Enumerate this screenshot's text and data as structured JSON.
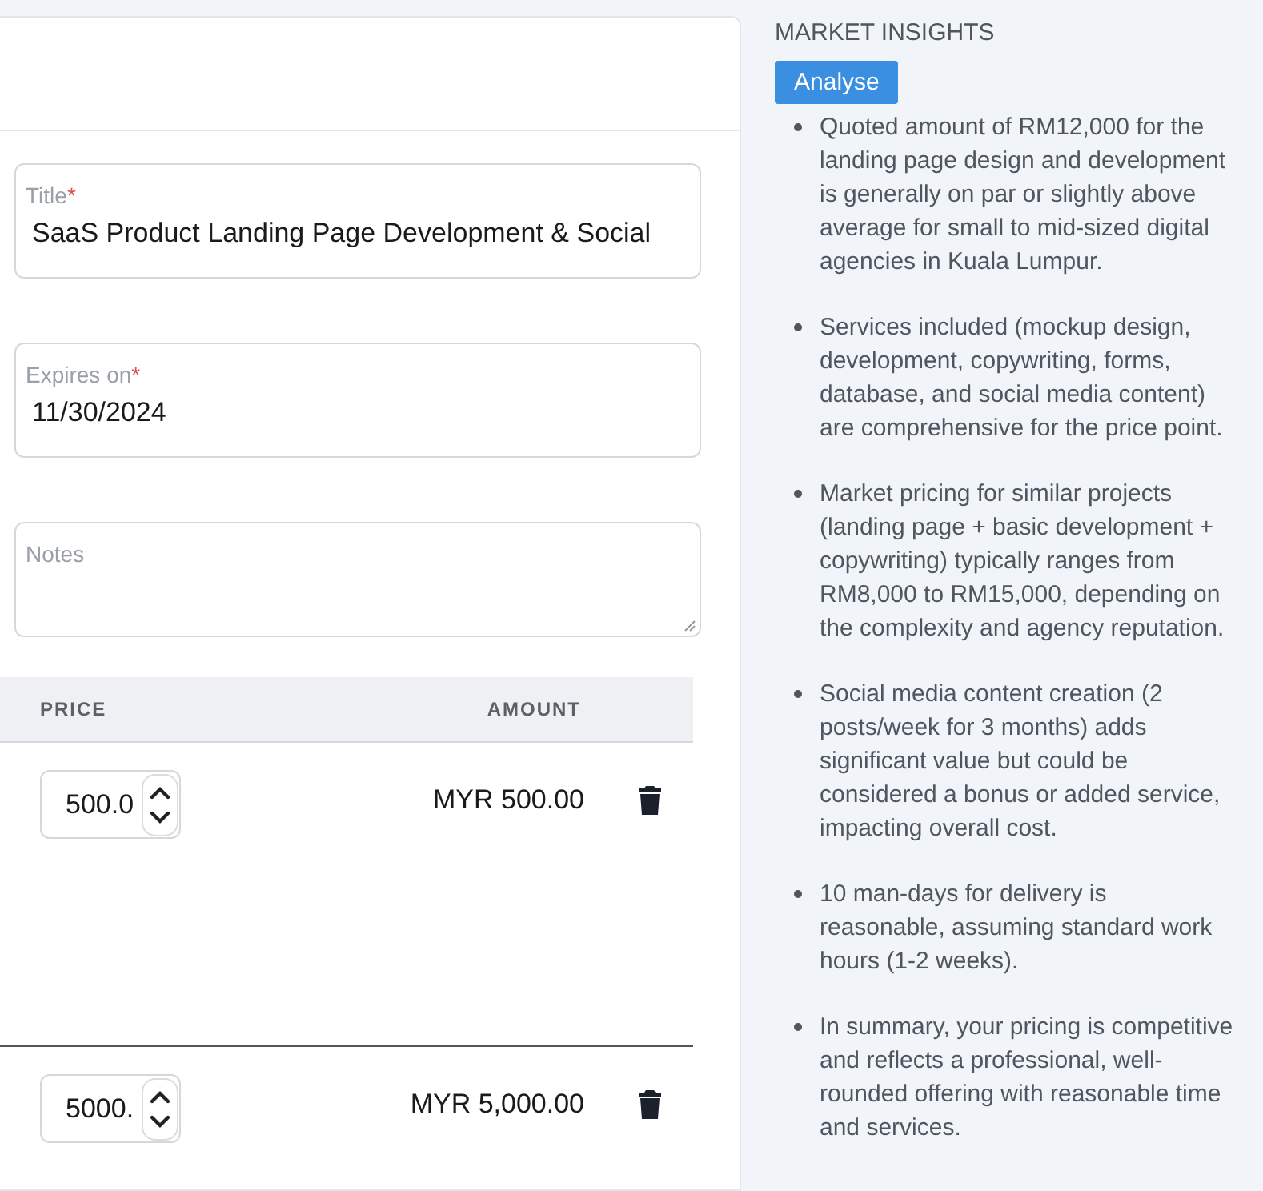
{
  "form": {
    "fields": [
      {
        "label": "Title",
        "required_mark": "*",
        "value": "SaaS Product Landing Page Development & Social",
        "kind": "text"
      },
      {
        "label": "Expires on",
        "required_mark": "*",
        "value": "11/30/2024",
        "kind": "text"
      },
      {
        "label": "Notes",
        "kind": "textarea"
      }
    ]
  },
  "table": {
    "columns": [
      "PRICE",
      "AMOUNT"
    ],
    "rows": [
      {
        "price": "500.0",
        "amount": "MYR 500.00"
      },
      {
        "price": "5000.",
        "amount": "MYR 5,000.00"
      }
    ]
  },
  "insights": {
    "title": "MARKET INSIGHTS",
    "button": "Analyse",
    "items": [
      "Quoted amount of RM12,000 for the landing page design and development is generally on par or slightly above average for small to mid-sized digital agencies in Kuala Lumpur.",
      "Services included (mockup design, development, copywriting, forms, database, and social media content) are comprehensive for the price point.",
      "Market pricing for similar projects (landing page + basic development + copywriting) typically ranges from RM8,000 to RM15,000, depending on the complexity and agency reputation.",
      "Social media content creation (2 posts/week for 3 months) adds significant value but could be considered a bonus or added service, impacting overall cost.",
      "10 man-days for delivery is reasonable, assuming standard work hours (1-2 weeks).",
      "In summary, your pricing is competitive and reflects a professional, well-rounded offering with reasonable time and services."
    ]
  }
}
